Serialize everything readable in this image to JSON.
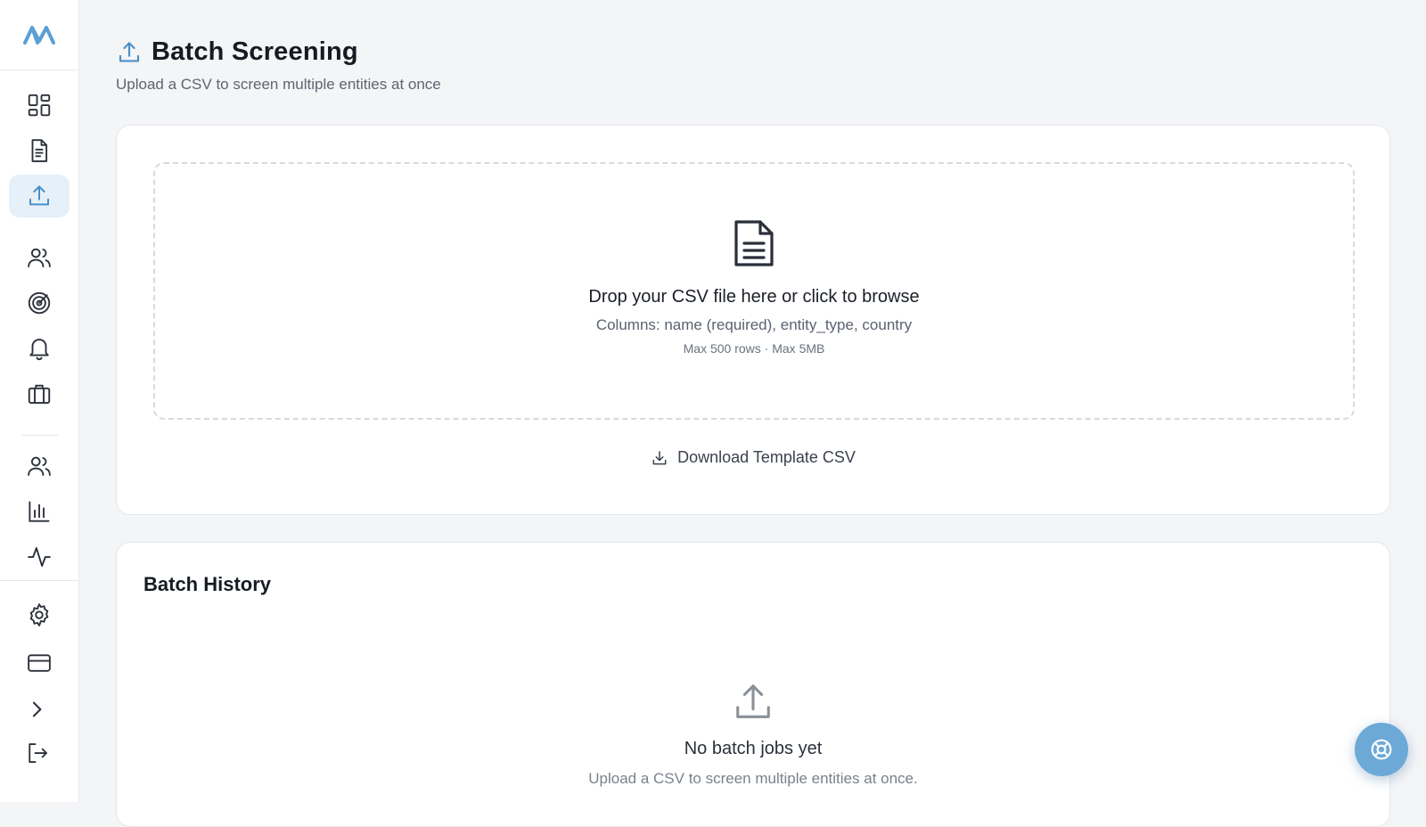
{
  "app": {
    "accent_color": "#4a8fc8",
    "fab_color": "#6ca9d7"
  },
  "sidebar": {
    "logo": "brand-logo",
    "items": [
      {
        "id": "dashboard",
        "icon": "dashboard-grid-icon"
      },
      {
        "id": "reports",
        "icon": "document-icon"
      },
      {
        "id": "batch-screening",
        "icon": "upload-icon",
        "active": true
      },
      {
        "id": "entities",
        "icon": "users-icon"
      },
      {
        "id": "monitoring",
        "icon": "radar-icon"
      },
      {
        "id": "alerts",
        "icon": "bell-icon"
      },
      {
        "id": "cases",
        "icon": "briefcase-icon"
      },
      {
        "id": "team",
        "icon": "team-icon"
      },
      {
        "id": "analytics",
        "icon": "bar-chart-icon"
      },
      {
        "id": "activity",
        "icon": "activity-icon"
      },
      {
        "id": "settings",
        "icon": "gear-icon"
      },
      {
        "id": "billing",
        "icon": "credit-card-icon"
      },
      {
        "id": "expand",
        "icon": "chevron-right-icon"
      },
      {
        "id": "logout",
        "icon": "logout-icon"
      }
    ]
  },
  "header": {
    "title": "Batch Screening",
    "subtitle": "Upload a CSV to screen multiple entities at once"
  },
  "upload": {
    "drop_title": "Drop your CSV file here or click to browse",
    "columns_hint": "Columns: name (required), entity_type, country",
    "limits_hint": "Max 500 rows · Max 5MB",
    "download_label": "Download Template CSV"
  },
  "history": {
    "title": "Batch History",
    "empty_title": "No batch jobs yet",
    "empty_desc": "Upload a CSV to screen multiple entities at once."
  }
}
